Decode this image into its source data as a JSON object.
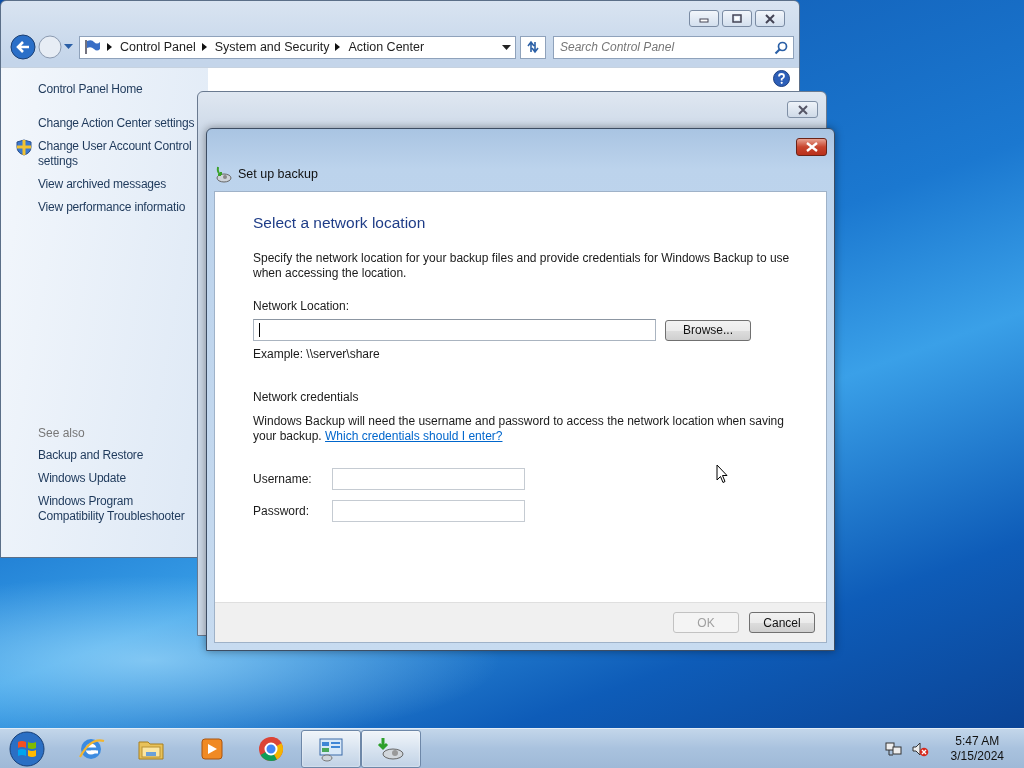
{
  "control_panel": {
    "address": {
      "crumbs": [
        "Control Panel",
        "System and Security",
        "Action Center"
      ]
    },
    "search": {
      "placeholder": "Search Control Panel"
    },
    "sidebar": {
      "home": "Control Panel Home",
      "tasks": [
        {
          "kind": "plain",
          "text": "Change Action Center settings"
        },
        {
          "kind": "shield",
          "text": "Change User Account Control settings"
        },
        {
          "kind": "plain",
          "text": "View archived messages"
        },
        {
          "kind": "plain",
          "text": "View performance informatio"
        }
      ],
      "see_also": {
        "title": "See also",
        "links": [
          "Backup and Restore",
          "Windows Update",
          "Windows Program Compatibility Troubleshooter"
        ]
      }
    }
  },
  "dialog": {
    "title": "Set up backup",
    "heading": "Select a network location",
    "intro": "Specify the network location for your backup files and provide credentials for Windows Backup to use when accessing the location.",
    "location": {
      "label": "Network Location:",
      "focused": true
    },
    "browse_button": "Browse...",
    "example": "Example: \\\\server\\share",
    "credentials": {
      "heading": "Network credentials",
      "text": "Windows Backup will need the username and password to access the network location when saving your backup.",
      "link": "Which credentials should I enter?"
    },
    "fields": [
      {
        "label": "Username:"
      },
      {
        "label": "Password:"
      }
    ],
    "buttons": [
      {
        "label": "OK",
        "disabled": true
      },
      {
        "label": "Cancel",
        "disabled": false
      }
    ]
  },
  "taskbar": {
    "items": [
      {
        "kind": "browser",
        "selected": false
      },
      {
        "kind": "folder",
        "selected": false
      },
      {
        "kind": "media",
        "selected": false
      },
      {
        "kind": "ring",
        "selected": false
      },
      {
        "kind": "panels",
        "selected": true
      },
      {
        "kind": "backup",
        "selected": true
      }
    ],
    "tray": {
      "volume_muted": true
    },
    "clock": {
      "time": "5:47 AM",
      "date": "3/15/2024"
    }
  }
}
